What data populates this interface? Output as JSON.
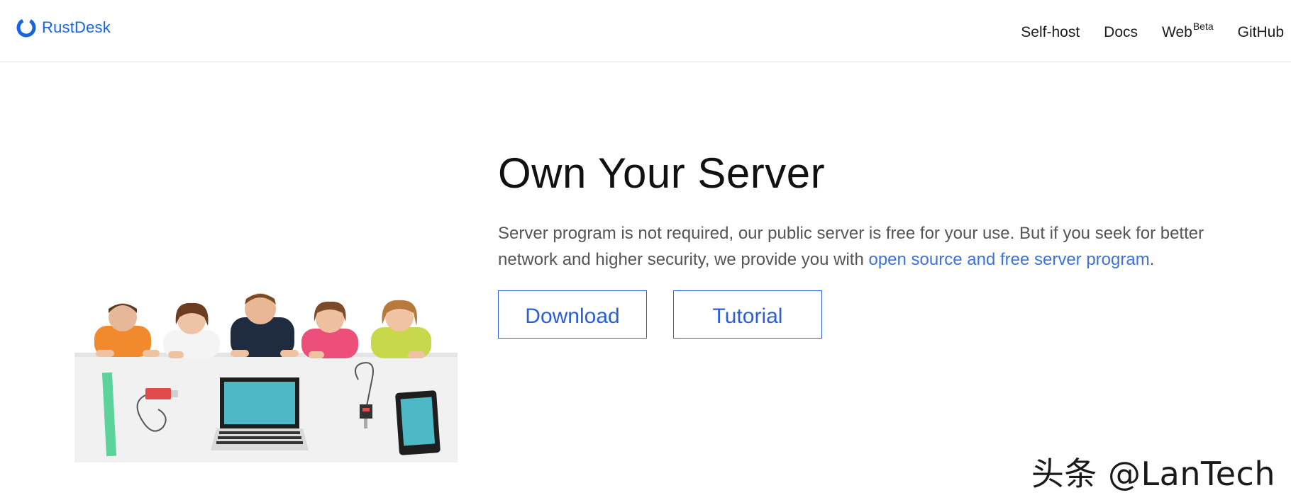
{
  "brand": {
    "name": "RustDesk",
    "logo_icon": "rustdesk-ring-logo",
    "accent_color": "#1565e0"
  },
  "nav": {
    "items": [
      {
        "label": "Self-host"
      },
      {
        "label": "Docs"
      },
      {
        "label": "Web",
        "sup": "Beta"
      },
      {
        "label": "GitHub"
      }
    ]
  },
  "hero": {
    "title": "Own Your Server",
    "description_prefix": "Server program is not required, our public server is free for your use. But if you seek for better network and higher security, we provide you with ",
    "description_link": "open source and free server program",
    "description_suffix": ".",
    "buttons": {
      "download_label": "Download",
      "tutorial_label": "Tutorial"
    },
    "button_color": "#2b5fd9"
  },
  "watermark": {
    "text": "头条 @LanTech"
  }
}
